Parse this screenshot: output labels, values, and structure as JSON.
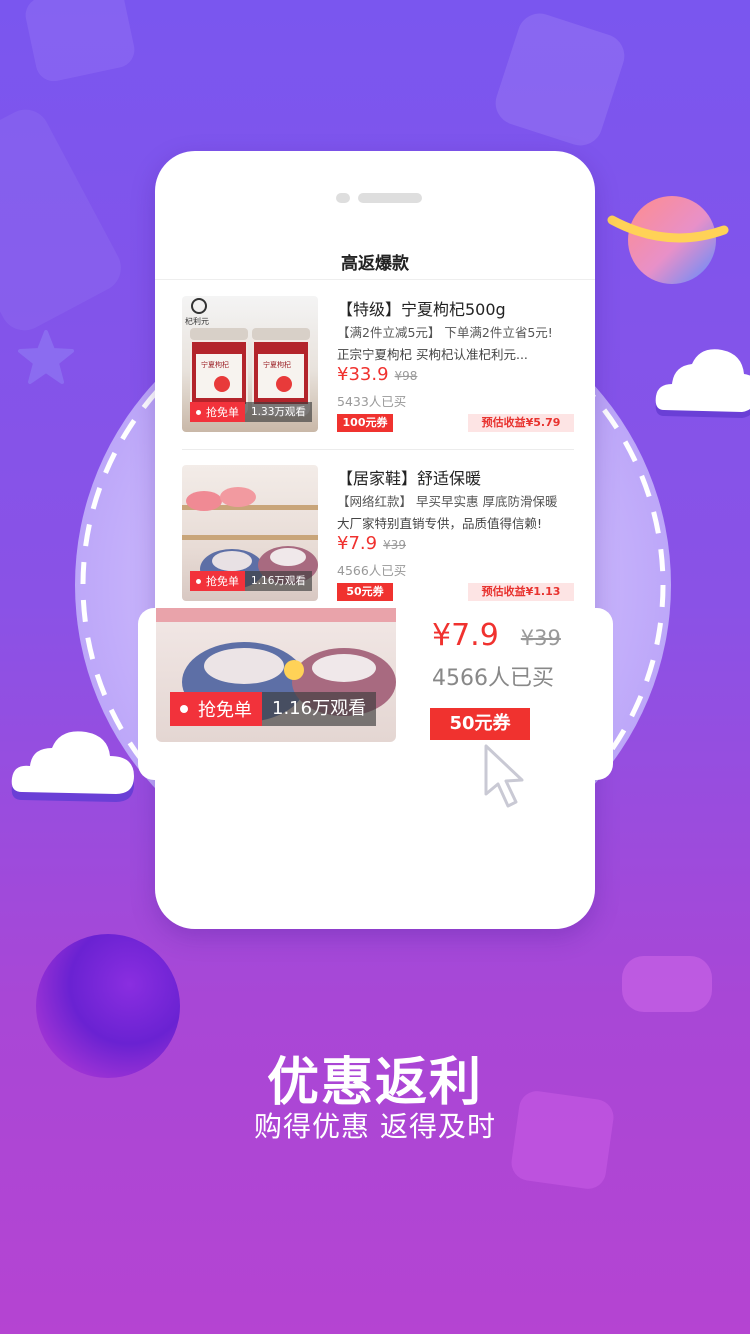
{
  "phone": {
    "section_title": "高返爆款",
    "products": [
      {
        "title": "【特级】宁夏枸杞500g",
        "subtitle": "【满2件立减5元】 下单满2件立省5元!",
        "description": "正宗宁夏枸杞 买枸杞认准杞利元...",
        "price": "¥33.9",
        "old_price": "¥98",
        "sold": "5433人已买",
        "coupon": "100元券",
        "earnings": "预估收益¥5.79",
        "badge_label": "抢免单",
        "badge_views": "1.33万观看",
        "jar_brand": "杞利元",
        "jar_label": "宁夏枸杞"
      },
      {
        "title": "【居家鞋】舒适保暖",
        "subtitle": "【网络红款】 早买早实惠 厚底防滑保暖",
        "description": "大厂家特别直销专供，品质值得信赖!",
        "price": "¥7.9",
        "old_price": "¥39",
        "sold": "4566人已买",
        "coupon": "50元券",
        "earnings": "预估收益¥1.13",
        "badge_label": "抢免单",
        "badge_views": "1.16万观看"
      }
    ]
  },
  "zoom": {
    "price": "¥7.9",
    "old_price": "¥39",
    "sold": "4566人已买",
    "coupon": "50元券",
    "badge_label": "抢免单",
    "badge_views": "1.16万观看"
  },
  "headline": "优惠返利",
  "subline": "购得优惠  返得及时",
  "colors": {
    "accent_red": "#f0322f",
    "background_top": "#7a56ef",
    "background_bottom": "#b544d2"
  }
}
